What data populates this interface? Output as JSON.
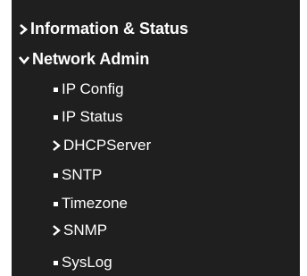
{
  "menu": {
    "info_status": {
      "label": "Information & Status",
      "icon": "chevron-right-icon"
    },
    "network_admin": {
      "label": "Network Admin",
      "icon": "chevron-down-icon",
      "children": [
        {
          "label": "IP Config",
          "icon": "bullet-icon"
        },
        {
          "label": "IP Status",
          "icon": "bullet-icon"
        },
        {
          "label": "DHCPServer",
          "icon": "chevron-right-icon"
        },
        {
          "label": "SNTP",
          "icon": "bullet-icon"
        },
        {
          "label": "Timezone",
          "icon": "bullet-icon"
        },
        {
          "label": "SNMP",
          "icon": "chevron-right-icon"
        },
        {
          "label": "SysLog",
          "icon": "bullet-icon"
        }
      ]
    }
  },
  "colors": {
    "background": "#1f1f1f",
    "text": "#ffffff"
  }
}
